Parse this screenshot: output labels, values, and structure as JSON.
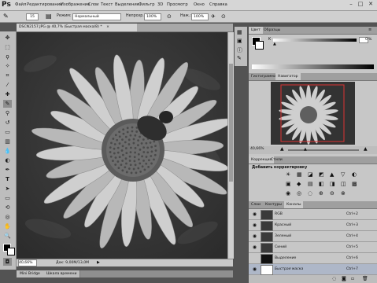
{
  "app": {
    "logo": "Ps"
  },
  "menubar": {
    "items": [
      "Файл",
      "Редактирование",
      "Изображение",
      "Слои",
      "Текст",
      "Выделение",
      "Фильтр",
      "3D",
      "Просмотр",
      "Окно",
      "Справка"
    ],
    "window_controls": [
      "–",
      "□",
      "✕"
    ]
  },
  "options": {
    "brush_size": "15",
    "mode_label": "Режим:",
    "mode_value": "Нормальный",
    "opacity_label": "Непрозр.:",
    "opacity_value": "100%",
    "flow_label": "Наж.:",
    "flow_value": "100%"
  },
  "document": {
    "tab_title": "DSCN2157.JPG @ 40,7% (Быстрая маска/8) *",
    "zoom": "40,66%",
    "doc_info": "Док: 9,00M/13,0M"
  },
  "bottom_tabs": [
    "Mini Bridge",
    "Шкала времени"
  ],
  "color_panel": {
    "tabs": [
      "Цвет",
      "Образцы"
    ],
    "channel_label": "K",
    "channel_value": "0",
    "unit": "%"
  },
  "navigator_panel": {
    "tabs": [
      "Гистограмма",
      "Навигатор"
    ],
    "zoom": "40,66%"
  },
  "adjustments_panel": {
    "tabs": [
      "Коррекция",
      "Стили"
    ],
    "title": "Добавить корректировку"
  },
  "channels_panel": {
    "tabs": [
      "Слои",
      "Контуры",
      "Каналы"
    ],
    "rows": [
      {
        "name": "RGB",
        "shortcut": "Ctrl+2"
      },
      {
        "name": "Красный",
        "shortcut": "Ctrl+3"
      },
      {
        "name": "Зеленый",
        "shortcut": "Ctrl+4"
      },
      {
        "name": "Синий",
        "shortcut": "Ctrl+5"
      },
      {
        "name": "Выделение",
        "shortcut": "Ctrl+6"
      },
      {
        "name": "Быстрая маска",
        "shortcut": "Ctrl+7"
      }
    ]
  },
  "colors": {
    "ui_bg": "#535353",
    "panel": "#c7c7c7",
    "menubar": "#d6d6d6"
  }
}
